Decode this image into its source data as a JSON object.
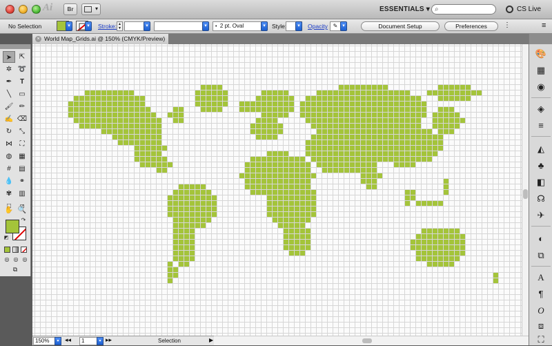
{
  "colors": {
    "accent_fill": "#a4c43a",
    "stroke_none": "#d00000",
    "link": "#1a3cc7"
  },
  "titlebar": {
    "app_logo": "Ai",
    "bridge_label": "Br",
    "workspace": "ESSENTIALS ▾",
    "search_placeholder": "",
    "cs_live": "CS Live"
  },
  "controlbar": {
    "selection_state": "No Selection",
    "stroke_label": "Stroke:",
    "brush_value": "2 pt. Oval",
    "style_label": "Style:",
    "opacity_label": "Opacity",
    "document_setup": "Document Setup",
    "preferences": "Preferences"
  },
  "document": {
    "tab_title": "World Map_Grids.ai @ 150% (CMYK/Preview)"
  },
  "statusbar": {
    "zoom": "150%",
    "artboard": "1",
    "current_tool": "Selection"
  }
}
